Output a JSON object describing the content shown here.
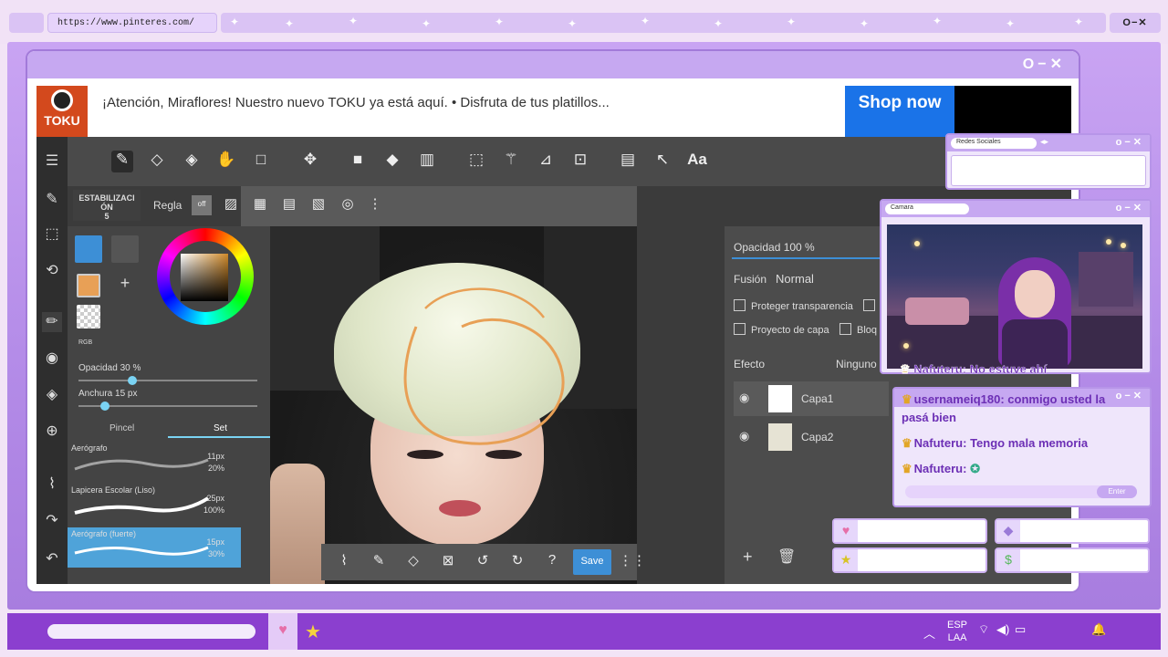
{
  "browser": {
    "url": "https://www.pinteres.com/",
    "window_controls": "O−✕"
  },
  "main_window": {
    "controls": "O−✕"
  },
  "ad": {
    "brand": "TOKU",
    "text": "¡Atención, Miraflores! Nuestro nuevo TOKU ya está aquí. • Disfruta de tus platillos...",
    "cta": "Shop now"
  },
  "paint_app": {
    "stabilizer_label": "ESTABILIZACI ÓN",
    "stabilizer_value": "5",
    "ruler_label": "Regla",
    "ruler_off": "off",
    "text_tool_label": "Aa",
    "color_mode": "RGB",
    "opacity_label": "Opacidad 30 %",
    "opacity_fraction": 0.3,
    "width_label": "Anchura 15 px",
    "width_fraction": 0.15,
    "tab_brush": "Pincel",
    "tab_set": "Set",
    "brushes": [
      {
        "name": "Aerógrafo",
        "size": "11px",
        "opacity": "20%"
      },
      {
        "name": "Lapicera Escolar (Liso)",
        "size": "25px",
        "opacity": "100%"
      },
      {
        "name": "Aerógrafo (fuerte)",
        "size": "15px",
        "opacity": "30%"
      }
    ],
    "save_label": "Save",
    "layers_panel": {
      "opacity": "Opacidad  100 %",
      "opacity_fraction": 1.0,
      "blend_label": "Fusión",
      "blend_value": "Normal",
      "protect_transparency": "Proteger transparencia",
      "clip_layer": "Proyecto de capa",
      "lock": "Bloq",
      "effect_label": "Efecto",
      "effect_value": "Ninguno",
      "layers": [
        {
          "name": "Capa1"
        },
        {
          "name": "Capa2"
        }
      ]
    }
  },
  "widgets": {
    "social": {
      "title": "Redes Sociales"
    },
    "camera": {
      "title": "Camara"
    },
    "chat": {
      "overlay_line": "Nafuteru: No estuve ahí",
      "lines": [
        {
          "user": "usernameiq180",
          "text": "conmigo usted la pasá bien"
        },
        {
          "user": "Nafuteru",
          "text": "Tengo mala memoria"
        },
        {
          "user": "Nafuteru",
          "text": ""
        }
      ],
      "enter_label": "Enter"
    },
    "stats": [
      {
        "icon": "heart-icon"
      },
      {
        "icon": "diamond-icon"
      },
      {
        "icon": "star-icon"
      },
      {
        "icon": "dollar-icon"
      }
    ]
  },
  "taskbar": {
    "lang_top": "ESP",
    "lang_bottom": "LAA"
  },
  "colors": {
    "accent_purple": "#8b3fcf",
    "window_border": "#a27ad9",
    "shop_button": "#1a73e8",
    "current_color": "#e8a056",
    "selected_brush": "#4fa3d9"
  }
}
